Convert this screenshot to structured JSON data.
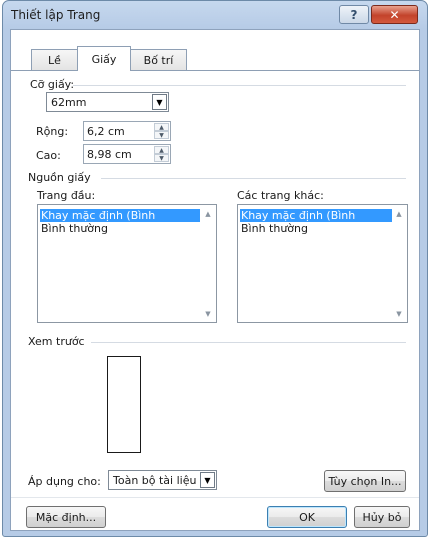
{
  "window": {
    "title": "Thiết lập Trang",
    "help_glyph": "?",
    "close_glyph": "✕"
  },
  "tabs": [
    {
      "label": "Lề"
    },
    {
      "label": "Giấy"
    },
    {
      "label": "Bố trí"
    }
  ],
  "paper_size": {
    "section_label": "Cỡ giấy:",
    "selected": "62mm",
    "width_label": "Rộng:",
    "width_value": "6,2 cm",
    "height_label": "Cao:",
    "height_value": "8,98 cm"
  },
  "paper_source": {
    "section_label": "Nguồn giấy",
    "first_page_label": "Trang đầu:",
    "first_page_items": [
      "Khay mặc định (Bình thường)",
      "Bình thường"
    ],
    "other_pages_label": "Các trang khác:",
    "other_pages_items": [
      "Khay mặc định (Bình thường)",
      "Bình thường"
    ]
  },
  "preview": {
    "section_label": "Xem trước"
  },
  "apply_to": {
    "label": "Áp dụng cho:",
    "selected": "Toàn bộ tài liệu"
  },
  "buttons": {
    "print_options": "Tùy chọn In...",
    "set_default": "Mặc định...",
    "ok": "OK",
    "cancel": "Hủy bỏ"
  },
  "icons": {
    "dropdown": "chevron-down-icon",
    "spin_up": "arrow-up-icon",
    "spin_down": "arrow-down-icon"
  },
  "colors": {
    "selection": "#3399ff",
    "title_bar": "#b6cbe6",
    "close_button": "#c3432b"
  }
}
